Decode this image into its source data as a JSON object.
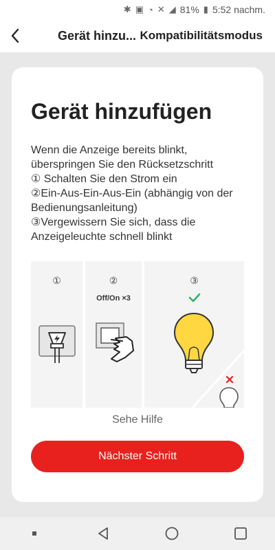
{
  "status_bar": {
    "battery": "81%",
    "time": "5:52 nachm."
  },
  "nav": {
    "title": "Gerät hinzu...",
    "action": "Kompatibilitätsmodus"
  },
  "card": {
    "title": "Gerät hinzufügen",
    "instructions": [
      "Wenn die Anzeige bereits blinkt, überspringen Sie den Rücksetzschritt",
      "① Schalten Sie den Strom ein",
      "②Ein-Aus-Ein-Aus-Ein (abhängig von der Bedienungsanleitung)",
      "③Vergewissern Sie sich, dass die Anzeigeleuchte schnell blinkt"
    ],
    "illustration": {
      "step1": "①",
      "step2": "②",
      "step2_caption": "Off/On ×3",
      "step3": "③"
    },
    "help_link": "Sehe Hilfe",
    "next_button": "Nächster Schritt"
  },
  "colors": {
    "accent": "#e8211f",
    "check": "#2fb36a",
    "bulb": "#ffd740"
  }
}
